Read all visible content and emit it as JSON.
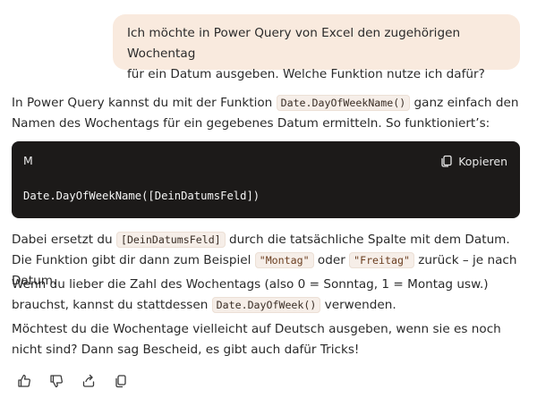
{
  "user_message": {
    "line1": "Ich möchte in Power Query von Excel den zugehörigen Wochentag",
    "line2": "für ein Datum ausgeben. Welche Funktion nutze ich dafür?"
  },
  "assistant": {
    "intro_before": "In Power Query kannst du mit der Funktion ",
    "intro_code": "Date.DayOfWeekName()",
    "intro_after": " ganz einfach den Namen des Wochentags für ein gegebenes Datum ermitteln. So funktioniert’s:",
    "code_block": {
      "language": "M",
      "copy_label": "Kopieren",
      "code": "Date.DayOfWeekName([DeinDatumsFeld])"
    },
    "p2_a": "Dabei ersetzt du ",
    "p2_code1": "[DeinDatumsFeld]",
    "p2_b": " durch die tatsächliche Spalte mit dem Datum. Die Funktion gibt dir dann zum Beispiel ",
    "p2_code2": "\"Montag\"",
    "p2_c": " oder ",
    "p2_code3": "\"Freitag\"",
    "p2_d": " zurück – je nach Datum.",
    "p3_a": "Wenn du lieber die Zahl des Wochentags (also 0 = Sonntag, 1 = Montag usw.) brauchst, kannst du stattdessen ",
    "p3_code": "Date.DayOfWeek()",
    "p3_b": " verwenden.",
    "p4": "Möchtest du die Wochentage vielleicht auf Deutsch ausgeben, wenn sie es noch nicht sind? Dann sag Bescheid, es gibt auch dafür Tricks!"
  },
  "actions": {
    "icons": [
      "thumbs-up-icon",
      "thumbs-down-icon",
      "share-icon",
      "copy-icon"
    ]
  },
  "colors": {
    "user_bubble": "#f9eade",
    "code_block_bg": "#1c1a19",
    "inline_code_bg": "#f6eee8"
  }
}
